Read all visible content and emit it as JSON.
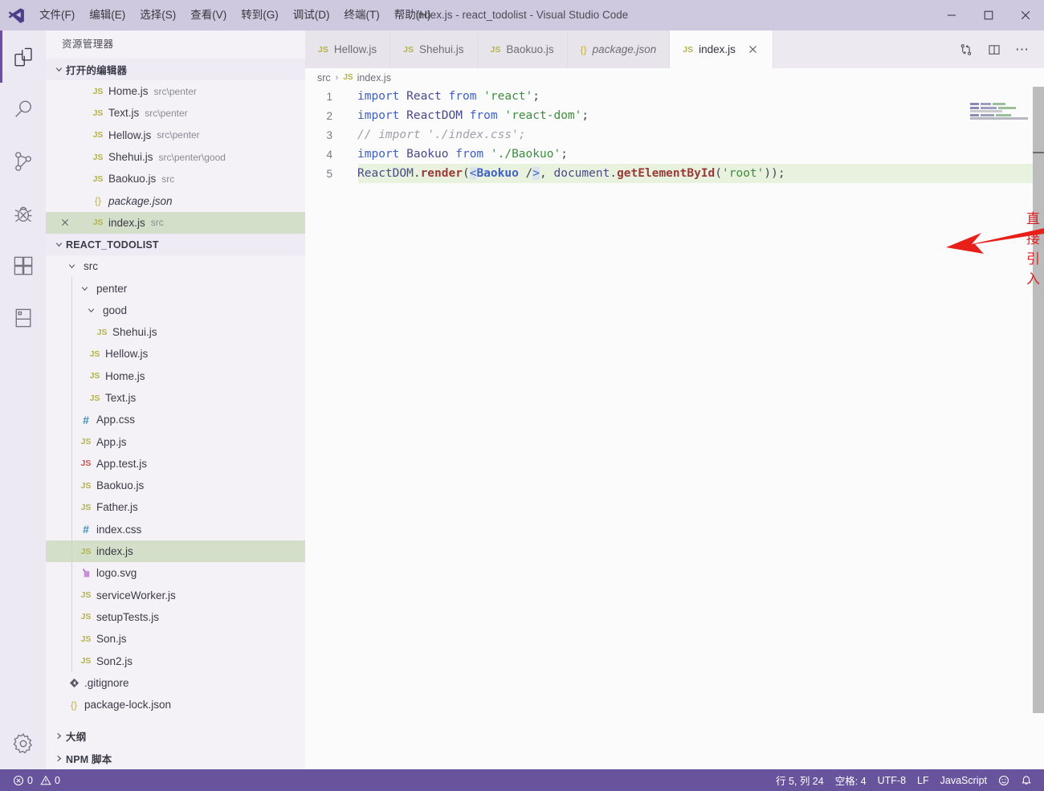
{
  "window": {
    "title": "index.js - react_todolist - Visual Studio Code",
    "minimize_label": "minimize-icon",
    "maximize_label": "maximize-icon",
    "close_label": "close-icon"
  },
  "menubar": {
    "items": [
      {
        "label": "文件(F)"
      },
      {
        "label": "编辑(E)"
      },
      {
        "label": "选择(S)"
      },
      {
        "label": "查看(V)"
      },
      {
        "label": "转到(G)"
      },
      {
        "label": "调试(D)"
      },
      {
        "label": "终端(T)"
      },
      {
        "label": "帮助(H)"
      }
    ]
  },
  "activitybar": {
    "items": [
      {
        "name": "explorer",
        "active": true
      },
      {
        "name": "search",
        "active": false
      },
      {
        "name": "source-control",
        "active": false
      },
      {
        "name": "debug",
        "active": false
      },
      {
        "name": "extensions",
        "active": false
      },
      {
        "name": "remote-explorer",
        "active": false
      }
    ],
    "settings": "gear-icon"
  },
  "sidebar": {
    "title": "资源管理器",
    "open_editors": {
      "header": "打开的编辑器",
      "items": [
        {
          "icon": "js",
          "name": "Home.js",
          "desc": "src\\penter",
          "italic": false,
          "selected": false,
          "closable": false
        },
        {
          "icon": "js",
          "name": "Text.js",
          "desc": "src\\penter",
          "italic": false,
          "selected": false,
          "closable": false
        },
        {
          "icon": "js",
          "name": "Hellow.js",
          "desc": "src\\penter",
          "italic": false,
          "selected": false,
          "closable": false
        },
        {
          "icon": "js",
          "name": "Shehui.js",
          "desc": "src\\penter\\good",
          "italic": false,
          "selected": false,
          "closable": false
        },
        {
          "icon": "js",
          "name": "Baokuo.js",
          "desc": "src",
          "italic": false,
          "selected": false,
          "closable": false
        },
        {
          "icon": "json",
          "name": "package.json",
          "desc": "",
          "italic": true,
          "selected": false,
          "closable": false
        },
        {
          "icon": "js",
          "name": "index.js",
          "desc": "src",
          "italic": false,
          "selected": true,
          "closable": true
        }
      ]
    },
    "project": {
      "header": "REACT_TODOLIST",
      "items": [
        {
          "kind": "folder",
          "icon": "",
          "name": "src",
          "depth": 0,
          "expanded": true,
          "selected": false
        },
        {
          "kind": "folder",
          "icon": "",
          "name": "penter",
          "depth": 1,
          "expanded": true,
          "selected": false
        },
        {
          "kind": "folder",
          "icon": "",
          "name": "good",
          "depth": 2,
          "expanded": true,
          "selected": false
        },
        {
          "kind": "file",
          "icon": "js",
          "name": "Shehui.js",
          "depth": 3,
          "expanded": false,
          "selected": false
        },
        {
          "kind": "file",
          "icon": "js",
          "name": "Hellow.js",
          "depth": 2,
          "expanded": false,
          "selected": false
        },
        {
          "kind": "file",
          "icon": "js",
          "name": "Home.js",
          "depth": 2,
          "expanded": false,
          "selected": false
        },
        {
          "kind": "file",
          "icon": "js",
          "name": "Text.js",
          "depth": 2,
          "expanded": false,
          "selected": false
        },
        {
          "kind": "file",
          "icon": "css",
          "name": "App.css",
          "depth": 1,
          "expanded": false,
          "selected": false
        },
        {
          "kind": "file",
          "icon": "js",
          "name": "App.js",
          "depth": 1,
          "expanded": false,
          "selected": false
        },
        {
          "kind": "file",
          "icon": "jsred",
          "name": "App.test.js",
          "depth": 1,
          "expanded": false,
          "selected": false
        },
        {
          "kind": "file",
          "icon": "js",
          "name": "Baokuo.js",
          "depth": 1,
          "expanded": false,
          "selected": false
        },
        {
          "kind": "file",
          "icon": "js",
          "name": "Father.js",
          "depth": 1,
          "expanded": false,
          "selected": false
        },
        {
          "kind": "file",
          "icon": "css",
          "name": "index.css",
          "depth": 1,
          "expanded": false,
          "selected": false
        },
        {
          "kind": "file",
          "icon": "js",
          "name": "index.js",
          "depth": 1,
          "expanded": false,
          "selected": true
        },
        {
          "kind": "file",
          "icon": "svg",
          "name": "logo.svg",
          "depth": 1,
          "expanded": false,
          "selected": false
        },
        {
          "kind": "file",
          "icon": "js",
          "name": "serviceWorker.js",
          "depth": 1,
          "expanded": false,
          "selected": false
        },
        {
          "kind": "file",
          "icon": "js",
          "name": "setupTests.js",
          "depth": 1,
          "expanded": false,
          "selected": false
        },
        {
          "kind": "file",
          "icon": "js",
          "name": "Son.js",
          "depth": 1,
          "expanded": false,
          "selected": false
        },
        {
          "kind": "file",
          "icon": "js",
          "name": "Son2.js",
          "depth": 1,
          "expanded": false,
          "selected": false
        },
        {
          "kind": "file",
          "icon": "git",
          "name": ".gitignore",
          "depth": 0,
          "expanded": false,
          "selected": false
        },
        {
          "kind": "file",
          "icon": "json",
          "name": "package-lock.json",
          "depth": 0,
          "expanded": false,
          "selected": false
        }
      ]
    },
    "outline_header": "大纲",
    "npm_header": "NPM 脚本"
  },
  "tabs": [
    {
      "icon": "js",
      "label": "Hellow.js",
      "active": false,
      "italic": false,
      "closable": false
    },
    {
      "icon": "js",
      "label": "Shehui.js",
      "active": false,
      "italic": false,
      "closable": false
    },
    {
      "icon": "js",
      "label": "Baokuo.js",
      "active": false,
      "italic": false,
      "closable": false
    },
    {
      "icon": "json",
      "label": "package.json",
      "active": false,
      "italic": true,
      "closable": false
    },
    {
      "icon": "js",
      "label": "index.js",
      "active": true,
      "italic": false,
      "closable": true
    }
  ],
  "tab_actions": {
    "split_editor": "split-editor-icon",
    "source_control": "source-control-compare-icon",
    "more": "⋯"
  },
  "breadcrumb": {
    "folder": "src",
    "separator": "›",
    "file": "index.js",
    "file_icon": "JS"
  },
  "editor": {
    "lines": [
      {
        "num": "1",
        "highlight": false,
        "tokens": [
          {
            "t": "import",
            "c": "kw"
          },
          {
            "t": " React ",
            "c": "var"
          },
          {
            "t": "from",
            "c": "kw"
          },
          {
            "t": " ",
            "c": "punc"
          },
          {
            "t": "'react'",
            "c": "str"
          },
          {
            "t": ";",
            "c": "punc"
          }
        ]
      },
      {
        "num": "2",
        "highlight": false,
        "tokens": [
          {
            "t": "import",
            "c": "kw"
          },
          {
            "t": " ReactDOM ",
            "c": "var"
          },
          {
            "t": "from",
            "c": "kw"
          },
          {
            "t": " ",
            "c": "punc"
          },
          {
            "t": "'react-dom'",
            "c": "str"
          },
          {
            "t": ";",
            "c": "punc"
          }
        ]
      },
      {
        "num": "3",
        "highlight": false,
        "tokens": [
          {
            "t": "// import './index.css';",
            "c": "cmt"
          }
        ]
      },
      {
        "num": "4",
        "highlight": false,
        "tokens": [
          {
            "t": "import",
            "c": "kw"
          },
          {
            "t": " Baokuo ",
            "c": "var"
          },
          {
            "t": "from",
            "c": "kw"
          },
          {
            "t": " ",
            "c": "punc"
          },
          {
            "t": "'./Baokuo'",
            "c": "str"
          },
          {
            "t": ";",
            "c": "punc"
          }
        ]
      },
      {
        "num": "5",
        "highlight": true,
        "tokens": [
          {
            "t": "ReactDOM",
            "c": "obj"
          },
          {
            "t": ".",
            "c": "punc"
          },
          {
            "t": "render",
            "c": "fn"
          },
          {
            "t": "(",
            "c": "punc"
          },
          {
            "t": "<",
            "c": "brack"
          },
          {
            "t": "Baokuo ",
            "c": "tag"
          },
          {
            "t": "/",
            "c": "punc"
          },
          {
            "t": ">",
            "c": "brack"
          },
          {
            "t": ", ",
            "c": "punc"
          },
          {
            "t": "document",
            "c": "obj"
          },
          {
            "t": ".",
            "c": "punc"
          },
          {
            "t": "getElementById",
            "c": "fn"
          },
          {
            "t": "(",
            "c": "punc"
          },
          {
            "t": "'root'",
            "c": "str"
          },
          {
            "t": "))",
            "c": "punc"
          },
          {
            "t": ";",
            "c": "punc"
          }
        ]
      }
    ]
  },
  "annotation": {
    "text": "直接引入",
    "color": "#e02020",
    "arrow": "red-arrow-pointing-left"
  },
  "statusbar": {
    "errors": "0",
    "warnings": "0",
    "cursor_position": "行 5, 列 24",
    "indentation": "空格: 4",
    "encoding": "UTF-8",
    "eol": "LF",
    "language": "JavaScript",
    "feedback": "smiley-icon",
    "notifications": "bell-icon"
  },
  "colors": {
    "titlebar_bg": "#cfc9e0",
    "activitybar_bg": "#ece9f2",
    "sidebar_bg": "#f4f2f7",
    "editor_bg": "#fbfbfc",
    "statusbar_bg": "#68549c",
    "selection_green": "#d3dfc8",
    "line_highlight": "#e8f2df",
    "accent": "#6b4fa0"
  }
}
